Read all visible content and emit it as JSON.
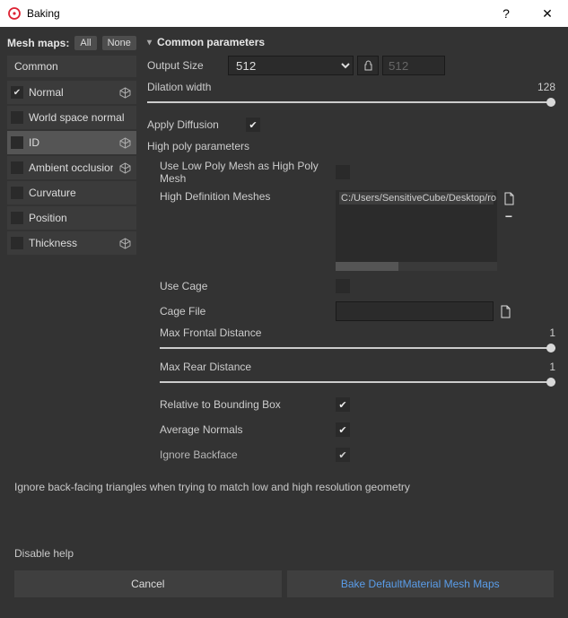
{
  "window": {
    "title": "Baking",
    "help_glyph": "?",
    "close_glyph": "✕"
  },
  "sidebar": {
    "mesh_maps_label": "Mesh maps:",
    "all_label": "All",
    "none_label": "None",
    "category_label": "Common",
    "items": [
      {
        "name": "Normal",
        "checked": true,
        "has_cube": true,
        "selected": false
      },
      {
        "name": "World space normal",
        "checked": false,
        "has_cube": false,
        "selected": false
      },
      {
        "name": "ID",
        "checked": false,
        "has_cube": true,
        "selected": true
      },
      {
        "name": "Ambient occlusion",
        "checked": false,
        "has_cube": true,
        "selected": false
      },
      {
        "name": "Curvature",
        "checked": false,
        "has_cube": false,
        "selected": false
      },
      {
        "name": "Position",
        "checked": false,
        "has_cube": false,
        "selected": false
      },
      {
        "name": "Thickness",
        "checked": false,
        "has_cube": true,
        "selected": false
      }
    ]
  },
  "content": {
    "section_title": "Common parameters",
    "output_size_label": "Output Size",
    "output_size_value": "512",
    "output_size_linked": "512",
    "dilation_label": "Dilation width",
    "dilation_value": "128",
    "apply_diffusion_label": "Apply Diffusion",
    "apply_diffusion_checked": true,
    "high_poly_header": "High poly parameters",
    "use_low_poly_label": "Use Low Poly Mesh as High Poly Mesh",
    "use_low_poly_checked": false,
    "high_def_label": "High Definition Meshes",
    "high_def_path": "C:/Users/SensitiveCube/Desktop/ro",
    "use_cage_label": "Use Cage",
    "use_cage_checked": false,
    "cage_file_label": "Cage File",
    "cage_file_value": "",
    "max_frontal_label": "Max Frontal Distance",
    "max_frontal_value": "1",
    "max_rear_label": "Max Rear Distance",
    "max_rear_value": "1",
    "relative_bbox_label": "Relative to Bounding Box",
    "relative_bbox_checked": true,
    "avg_normals_label": "Average Normals",
    "avg_normals_checked": true,
    "ignore_backface_label": "Ignore Backface",
    "ignore_backface_checked": true
  },
  "footer": {
    "hint": "Ignore back-facing triangles when trying to match low and high resolution geometry",
    "disable_help_label": "Disable help",
    "cancel_label": "Cancel",
    "bake_label": "Bake DefaultMaterial Mesh Maps"
  }
}
